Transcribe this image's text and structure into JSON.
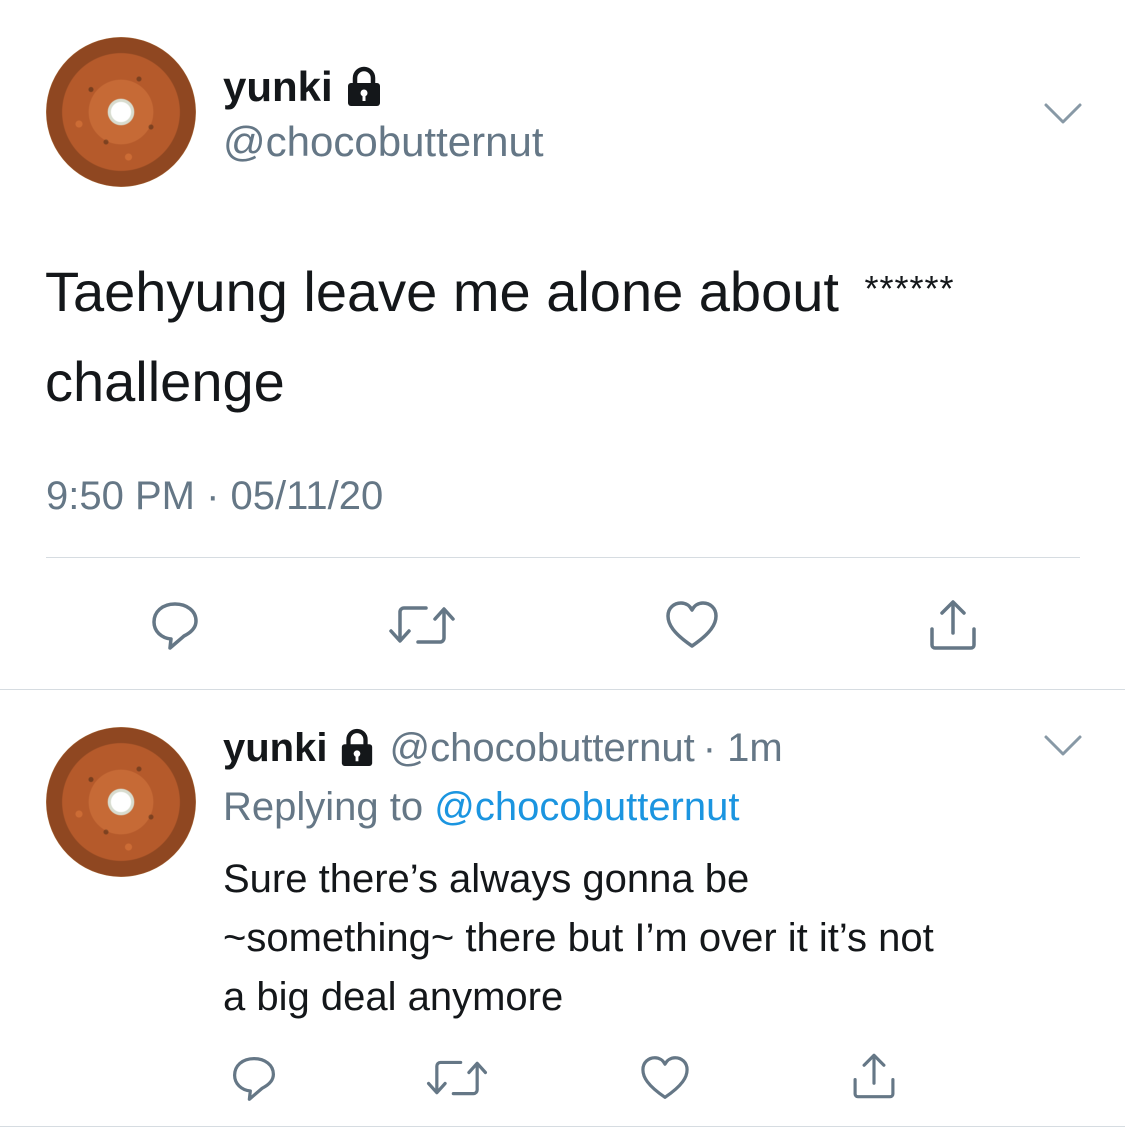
{
  "main_tweet": {
    "display_name": "yunki",
    "handle": "@chocobutternut",
    "text_line1": "Taehyung leave me alone about",
    "censored": "******",
    "text_line2": "challenge",
    "timestamp": "9:50 PM · 05/11/20",
    "icons": [
      "reply-icon",
      "retweet-icon",
      "like-icon",
      "share-icon"
    ]
  },
  "reply_tweet": {
    "display_name": "yunki",
    "handle": "@chocobutternut",
    "age": "· 1m",
    "replying_label": "Replying to",
    "replying_handle": "@chocobutternut",
    "text_line1": "Sure there’s always gonna be",
    "text_line2": "~something~ there but I’m over it it’s not",
    "text_line3": "a big deal anymore",
    "icons": [
      "reply-icon",
      "retweet-icon",
      "like-icon",
      "share-icon"
    ]
  },
  "colors": {
    "text": "#14171a",
    "secondary": "#657786",
    "link": "#1b95e0",
    "divider": "#d6dce1"
  }
}
